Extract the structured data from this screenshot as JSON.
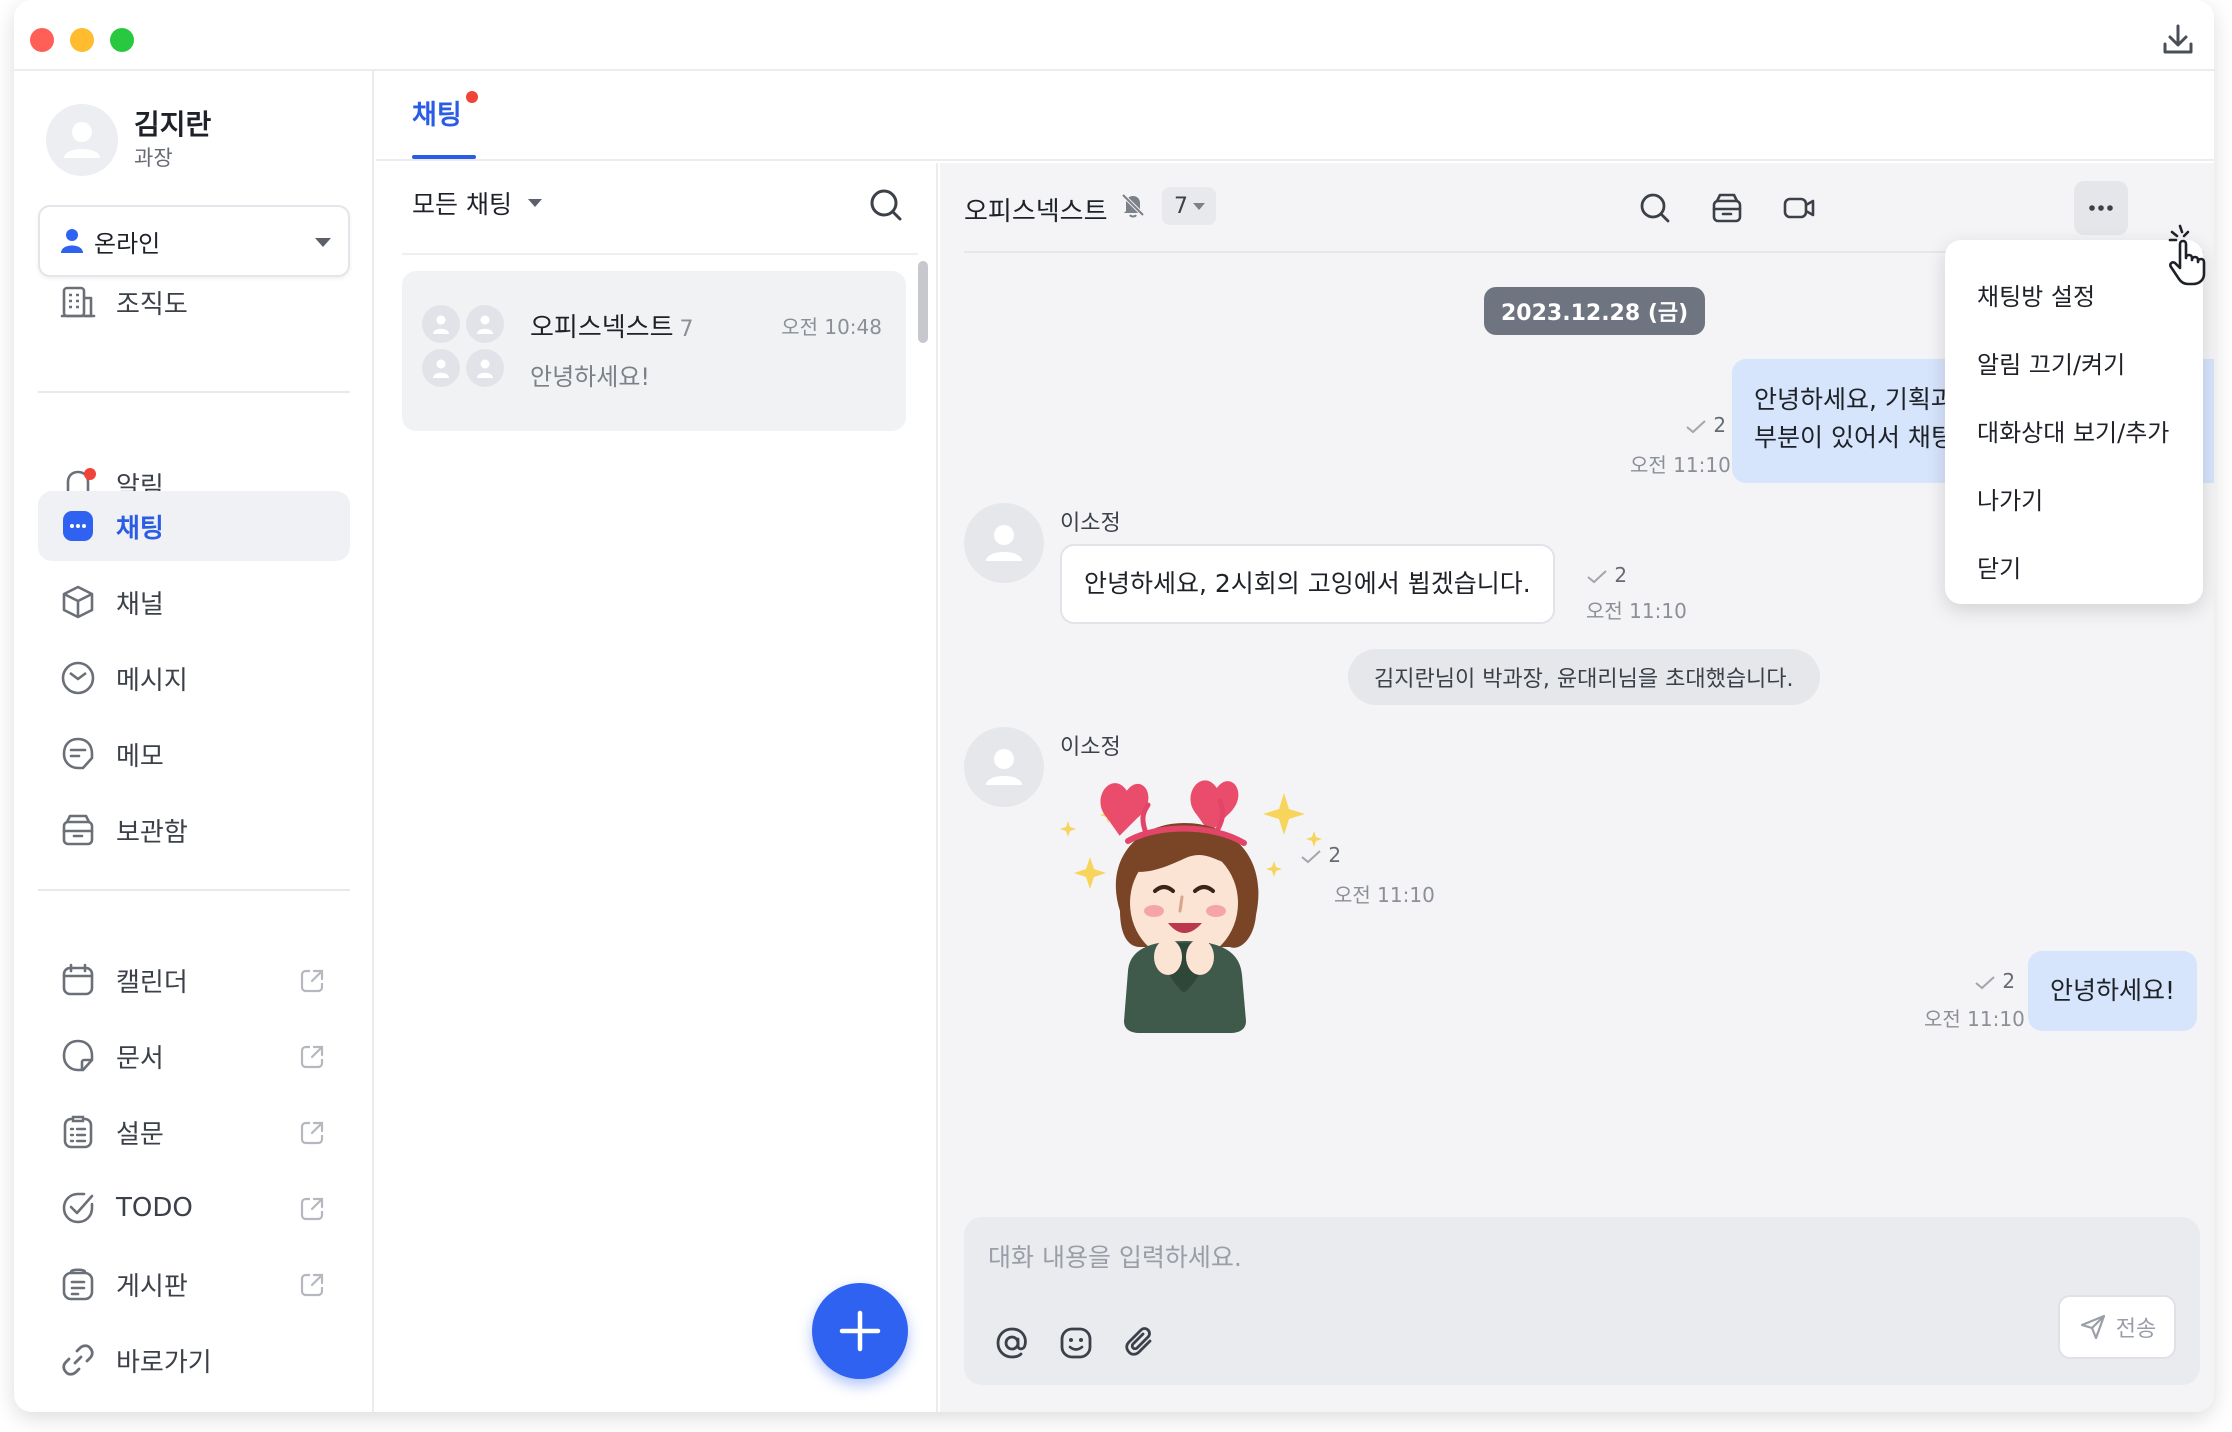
{
  "app": {
    "accent_color": "#2b5ce6"
  },
  "profile": {
    "name": "김지란",
    "title": "과장"
  },
  "status": {
    "label": "온라인",
    "color": "#2f62f0"
  },
  "sidebar": {
    "items": [
      {
        "label": "조직도",
        "icon": "org-chart-icon"
      },
      {
        "label": "알림",
        "icon": "bell-icon",
        "has_unread_dot": true
      },
      {
        "label": "채팅",
        "icon": "chat-bubble-icon",
        "active": true
      },
      {
        "label": "채널",
        "icon": "cube-icon"
      },
      {
        "label": "메시지",
        "icon": "mail-icon"
      },
      {
        "label": "메모",
        "icon": "memo-icon"
      },
      {
        "label": "보관함",
        "icon": "archive-icon"
      },
      {
        "label": "캘린더",
        "icon": "calendar-icon",
        "external": true
      },
      {
        "label": "문서",
        "icon": "document-icon",
        "external": true
      },
      {
        "label": "설문",
        "icon": "survey-icon",
        "external": true
      },
      {
        "label": "TODO",
        "icon": "todo-check-icon",
        "external": true
      },
      {
        "label": "게시판",
        "icon": "board-icon",
        "external": true
      },
      {
        "label": "바로가기",
        "icon": "link-icon"
      }
    ]
  },
  "tabs": {
    "chat_label": "채팅"
  },
  "chat_list": {
    "filter_label": "모든 채팅",
    "rows": [
      {
        "name": "오피스넥스트",
        "member_count": "7",
        "time": "오전 10:48",
        "preview": "안녕하세요!"
      }
    ]
  },
  "conversation": {
    "title": "오피스넥스트",
    "member_count": "7",
    "date": "2023.12.28 (금)",
    "messages": [
      {
        "type": "mine",
        "lines": [
          "안녕하세요, 기획과",
          "부분이 있어서 채팅"
        ],
        "read_count": "2",
        "time": "오전 11:10"
      },
      {
        "type": "theirs",
        "sender": "이소정",
        "text": "안녕하세요, 2시회의 고잉에서 뵙겠습니다.",
        "read_count": "2",
        "time": "오전 11:10"
      },
      {
        "type": "system",
        "text": "김지란님이 박과장, 윤대리님을 초대했습니다."
      },
      {
        "type": "sticker",
        "sender": "이소정",
        "read_count": "2",
        "time": "오전 11:10"
      },
      {
        "type": "mine",
        "text": "안녕하세요!",
        "read_count": "2",
        "time": "오전 11:10"
      }
    ],
    "composer": {
      "placeholder": "대화 내용을 입력하세요.",
      "send_label": "전송"
    }
  },
  "more_menu": {
    "items": [
      "채팅방 설정",
      "알림 끄기/켜기",
      "대화상대 보기/추가",
      "나가기",
      "닫기"
    ]
  }
}
